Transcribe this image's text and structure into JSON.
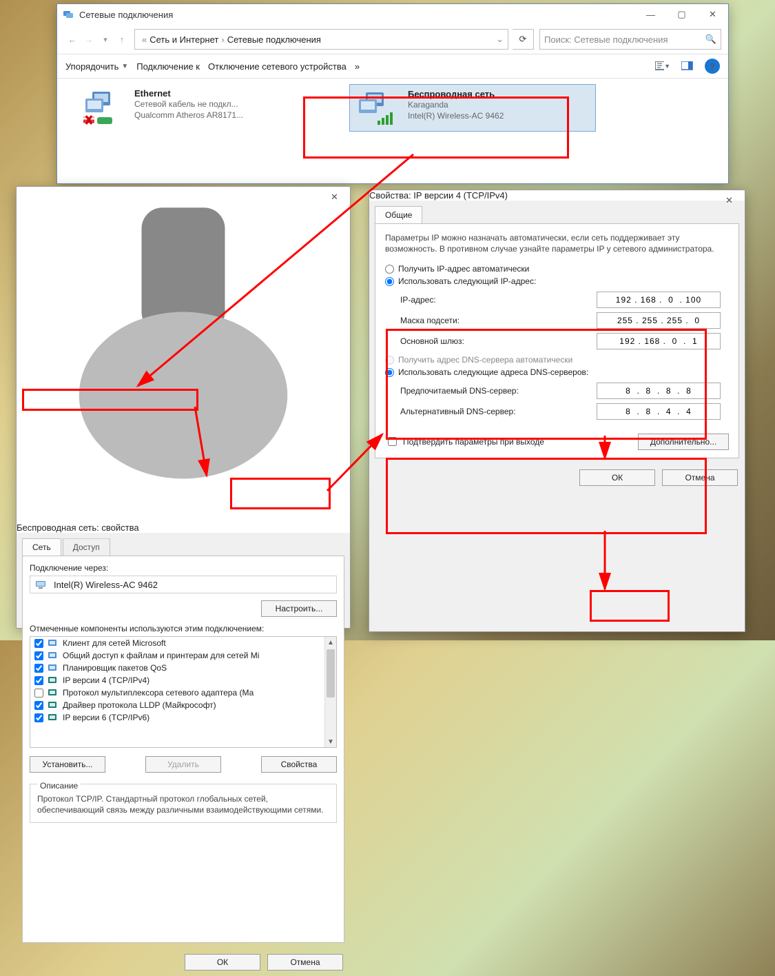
{
  "main_window": {
    "title": "Сетевые подключения",
    "breadcrumb": {
      "prefix": "«",
      "seg1": "Сеть и Интернет",
      "seg2": "Сетевые подключения"
    },
    "search_placeholder": "Поиск: Сетевые подключения",
    "toolbar": {
      "organize": "Упорядочить",
      "connect_to": "Подключение к",
      "disable_device": "Отключение сетевого устройства",
      "more": "»"
    },
    "ethernet": {
      "name": "Ethernet",
      "status": "Сетевой кабель не подкл...",
      "device": "Qualcomm Atheros AR8171..."
    },
    "wireless": {
      "name": "Беспроводная сеть",
      "status": "Karaganda",
      "device": "Intel(R) Wireless-AC 9462"
    }
  },
  "props_network_dialog": {
    "title": "Беспроводная сеть: свойства",
    "tab_network": "Сеть",
    "tab_sharing": "Доступ",
    "connect_using": "Подключение через:",
    "adapter": "Intel(R) Wireless-AC 9462",
    "configure": "Настроить...",
    "components_label": "Отмеченные компоненты используются этим подключением:",
    "components": [
      {
        "checked": true,
        "label": "Клиент для сетей Microsoft"
      },
      {
        "checked": true,
        "label": "Общий доступ к файлам и принтерам для сетей Mi"
      },
      {
        "checked": true,
        "label": "Планировщик пакетов QoS"
      },
      {
        "checked": true,
        "label": "IP версии 4 (TCP/IPv4)"
      },
      {
        "checked": false,
        "label": "Протокол мультиплексора сетевого адаптера (Ма"
      },
      {
        "checked": true,
        "label": "Драйвер протокола LLDP (Майкрософт)"
      },
      {
        "checked": true,
        "label": "IP версии 6 (TCP/IPv6)"
      }
    ],
    "install": "Установить...",
    "uninstall": "Удалить",
    "properties": "Свойства",
    "description_legend": "Описание",
    "description_text": "Протокол TCP/IP. Стандартный протокол глобальных сетей, обеспечивающий связь между различными взаимодействующими сетями.",
    "ok": "ОК",
    "cancel": "Отмена"
  },
  "ipv4_dialog": {
    "title": "Свойства: IP версии 4 (TCP/IPv4)",
    "tab_general": "Общие",
    "intro": "Параметры IP можно назначать автоматически, если сеть поддерживает эту возможность. В противном случае узнайте параметры IP у сетевого администратора.",
    "radio_auto_ip": "Получить IP-адрес автоматически",
    "radio_manual_ip": "Использовать следующий IP-адрес:",
    "ip_label": "IP-адрес:",
    "ip_value": "192 . 168 .  0  . 100",
    "mask_label": "Маска подсети:",
    "mask_value": "255 . 255 . 255 .  0",
    "gw_label": "Основной шлюз:",
    "gw_value": "192 . 168 .  0  .  1",
    "radio_auto_dns": "Получить адрес DNS-сервера автоматически",
    "radio_manual_dns": "Использовать следующие адреса DNS-серверов:",
    "dns1_label": "Предпочитаемый DNS-сервер:",
    "dns1_value": "8  .  8  .  8  .  8",
    "dns2_label": "Альтернативный DNS-сервер:",
    "dns2_value": "8  .  8  .  4  .  4",
    "validate": "Подтвердить параметры при выходе",
    "advanced": "Дополнительно...",
    "ok": "ОК",
    "cancel": "Отмена"
  }
}
